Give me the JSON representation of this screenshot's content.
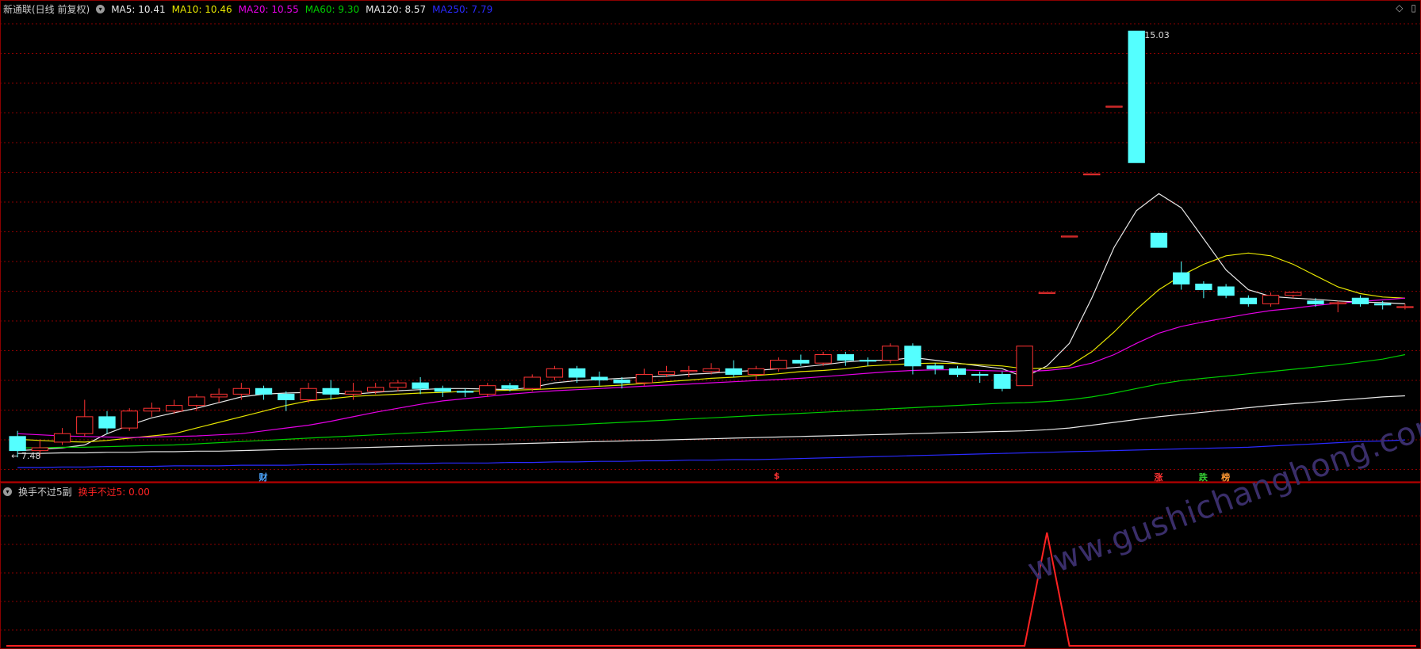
{
  "main": {
    "stock_title": "新通联(日线 前复权)",
    "ma_labels": [
      {
        "key": "MA5",
        "text": "MA5: 10.41",
        "color": "#e8e8e8"
      },
      {
        "key": "MA10",
        "text": "MA10: 10.46",
        "color": "#e6e600"
      },
      {
        "key": "MA20",
        "text": "MA20: 10.55",
        "color": "#e600e6"
      },
      {
        "key": "MA60",
        "text": "MA60: 9.30",
        "color": "#00cc00"
      },
      {
        "key": "MA120",
        "text": "MA120: 8.57",
        "color": "#e8e8e8"
      },
      {
        "key": "MA250",
        "text": "MA250: 7.79",
        "color": "#2a2aff"
      }
    ],
    "high_label": "15.03",
    "low_label": "7.48",
    "markers": [
      {
        "text": "财",
        "color": "#4da6ff"
      },
      {
        "text": "$",
        "color": "#ff3333"
      },
      {
        "text": "涨",
        "color": "#ff3333"
      },
      {
        "text": "跌",
        "color": "#33cc33"
      },
      {
        "text": "榜",
        "color": "#ff9933"
      }
    ],
    "corner_icons": [
      "diamond-icon",
      "window-icon"
    ],
    "colors": {
      "up": "#ff3333",
      "down": "#54ffff",
      "grid": "#8b0000"
    }
  },
  "sub": {
    "indicator_title": "换手不过5副",
    "indicator_value": "换手不过5: 0.00",
    "value_color": "#ff2222"
  },
  "watermark": "www.gushichanghong.com",
  "chart_data": {
    "type": "candlestick",
    "price_range": [
      7.3,
      15.3
    ],
    "candles": [
      [
        7.85,
        7.6,
        7.95,
        7.48
      ],
      [
        7.6,
        7.65,
        7.8,
        7.5
      ],
      [
        7.75,
        7.9,
        8.0,
        7.7
      ],
      [
        7.9,
        8.2,
        8.5,
        7.85
      ],
      [
        8.2,
        8.0,
        8.3,
        7.9
      ],
      [
        8.0,
        8.3,
        8.35,
        7.95
      ],
      [
        8.3,
        8.35,
        8.45,
        8.2
      ],
      [
        8.3,
        8.4,
        8.5,
        8.25
      ],
      [
        8.4,
        8.55,
        8.6,
        8.3
      ],
      [
        8.55,
        8.6,
        8.7,
        8.45
      ],
      [
        8.6,
        8.7,
        8.8,
        8.5
      ],
      [
        8.7,
        8.6,
        8.75,
        8.5
      ],
      [
        8.6,
        8.5,
        8.65,
        8.3
      ],
      [
        8.5,
        8.7,
        8.8,
        8.45
      ],
      [
        8.7,
        8.6,
        8.85,
        8.5
      ],
      [
        8.6,
        8.65,
        8.8,
        8.5
      ],
      [
        8.65,
        8.72,
        8.8,
        8.6
      ],
      [
        8.72,
        8.8,
        8.85,
        8.65
      ],
      [
        8.8,
        8.7,
        8.9,
        8.6
      ],
      [
        8.7,
        8.65,
        8.75,
        8.55
      ],
      [
        8.65,
        8.64,
        8.7,
        8.55
      ],
      [
        8.6,
        8.75,
        8.8,
        8.55
      ],
      [
        8.75,
        8.7,
        8.8,
        8.65
      ],
      [
        8.7,
        8.9,
        8.95,
        8.65
      ],
      [
        8.9,
        9.05,
        9.1,
        8.85
      ],
      [
        9.05,
        8.9,
        9.1,
        8.8
      ],
      [
        8.9,
        8.85,
        9.0,
        8.75
      ],
      [
        8.85,
        8.8,
        8.9,
        8.7
      ],
      [
        8.8,
        8.95,
        9.05,
        8.75
      ],
      [
        8.95,
        9.0,
        9.1,
        8.9
      ],
      [
        9.0,
        9.02,
        9.1,
        8.9
      ],
      [
        9.0,
        9.05,
        9.15,
        8.95
      ],
      [
        9.05,
        8.95,
        9.2,
        8.9
      ],
      [
        8.95,
        9.05,
        9.1,
        8.85
      ],
      [
        9.05,
        9.2,
        9.25,
        9.0
      ],
      [
        9.2,
        9.15,
        9.3,
        9.1
      ],
      [
        9.15,
        9.3,
        9.35,
        9.1
      ],
      [
        9.3,
        9.2,
        9.35,
        9.1
      ],
      [
        9.2,
        9.19,
        9.25,
        9.1
      ],
      [
        9.2,
        9.45,
        9.5,
        9.15
      ],
      [
        9.45,
        9.1,
        9.5,
        8.95
      ],
      [
        9.1,
        9.05,
        9.15,
        8.95
      ],
      [
        9.05,
        8.95,
        9.1,
        8.9
      ],
      [
        8.95,
        8.94,
        9.0,
        8.8
      ],
      [
        8.95,
        8.7,
        9.0,
        8.65
      ],
      [
        8.75,
        9.45,
        9.45,
        8.75
      ],
      [
        10.4,
        10.4,
        10.4,
        10.4
      ],
      [
        11.4,
        11.4,
        11.4,
        11.4
      ],
      [
        12.5,
        12.5,
        12.5,
        12.5
      ],
      [
        13.7,
        13.7,
        13.7,
        13.7
      ],
      [
        15.03,
        12.7,
        15.03,
        12.7
      ],
      [
        11.45,
        11.2,
        11.45,
        11.2
      ],
      [
        10.75,
        10.55,
        10.95,
        10.45
      ],
      [
        10.55,
        10.45,
        10.6,
        10.3
      ],
      [
        10.5,
        10.35,
        10.55,
        10.3
      ],
      [
        10.3,
        10.2,
        10.35,
        10.15
      ],
      [
        10.2,
        10.35,
        10.4,
        10.15
      ],
      [
        10.35,
        10.4,
        10.42,
        10.3
      ],
      [
        10.25,
        10.2,
        10.3,
        10.15
      ],
      [
        10.2,
        10.22,
        10.25,
        10.05
      ],
      [
        10.3,
        10.2,
        10.35,
        10.15
      ],
      [
        10.2,
        10.18,
        10.25,
        10.1
      ],
      [
        10.15,
        10.15,
        10.2,
        10.1
      ]
    ],
    "ma_series": [
      {
        "name": "MA5",
        "values": [
          7.6,
          7.62,
          7.65,
          7.7,
          7.9,
          8.05,
          8.18,
          8.27,
          8.35,
          8.45,
          8.55,
          8.6,
          8.62,
          8.63,
          8.62,
          8.6,
          8.63,
          8.66,
          8.68,
          8.7,
          8.7,
          8.69,
          8.68,
          8.72,
          8.8,
          8.84,
          8.86,
          8.88,
          8.9,
          8.92,
          8.95,
          8.97,
          9.0,
          9.02,
          9.05,
          9.08,
          9.12,
          9.17,
          9.2,
          9.2,
          9.25,
          9.2,
          9.15,
          9.1,
          9.05,
          8.9,
          9.1,
          9.5,
          10.3,
          11.2,
          11.85,
          12.15,
          11.9,
          11.35,
          10.8,
          10.45,
          10.33,
          10.3,
          10.28,
          10.25,
          10.23,
          10.22,
          10.2
        ]
      },
      {
        "name": "MA10",
        "values": [
          7.8,
          7.78,
          7.76,
          7.75,
          7.78,
          7.82,
          7.86,
          7.9,
          8.0,
          8.1,
          8.2,
          8.3,
          8.4,
          8.48,
          8.52,
          8.56,
          8.58,
          8.6,
          8.62,
          8.63,
          8.65,
          8.66,
          8.67,
          8.68,
          8.7,
          8.72,
          8.74,
          8.76,
          8.79,
          8.82,
          8.85,
          8.88,
          8.9,
          8.93,
          8.96,
          9.0,
          9.02,
          9.05,
          9.1,
          9.12,
          9.14,
          9.15,
          9.14,
          9.12,
          9.1,
          9.05,
          9.06,
          9.1,
          9.35,
          9.7,
          10.1,
          10.45,
          10.7,
          10.9,
          11.05,
          11.1,
          11.05,
          10.9,
          10.7,
          10.5,
          10.38,
          10.32,
          10.3
        ]
      },
      {
        "name": "MA20",
        "values": [
          7.9,
          7.88,
          7.86,
          7.85,
          7.84,
          7.83,
          7.84,
          7.85,
          7.86,
          7.88,
          7.9,
          7.95,
          8.0,
          8.05,
          8.12,
          8.2,
          8.28,
          8.35,
          8.42,
          8.48,
          8.52,
          8.56,
          8.6,
          8.63,
          8.66,
          8.68,
          8.7,
          8.72,
          8.74,
          8.76,
          8.78,
          8.8,
          8.82,
          8.84,
          8.86,
          8.88,
          8.91,
          8.94,
          8.97,
          9.0,
          9.02,
          9.03,
          9.03,
          9.02,
          9.01,
          9.0,
          9.02,
          9.06,
          9.15,
          9.3,
          9.5,
          9.68,
          9.8,
          9.88,
          9.95,
          10.02,
          10.08,
          10.12,
          10.17,
          10.21,
          10.24,
          10.27,
          10.3
        ]
      },
      {
        "name": "MA60",
        "values": [
          7.65,
          7.65,
          7.66,
          7.66,
          7.67,
          7.68,
          7.69,
          7.7,
          7.72,
          7.74,
          7.76,
          7.78,
          7.8,
          7.82,
          7.84,
          7.86,
          7.88,
          7.9,
          7.92,
          7.94,
          7.96,
          7.98,
          8.0,
          8.02,
          8.04,
          8.06,
          8.08,
          8.1,
          8.12,
          8.14,
          8.16,
          8.18,
          8.2,
          8.22,
          8.24,
          8.26,
          8.28,
          8.3,
          8.32,
          8.34,
          8.36,
          8.38,
          8.4,
          8.42,
          8.44,
          8.45,
          8.47,
          8.5,
          8.55,
          8.62,
          8.7,
          8.78,
          8.84,
          8.88,
          8.92,
          8.96,
          9.0,
          9.04,
          9.08,
          9.12,
          9.17,
          9.22,
          9.3
        ]
      },
      {
        "name": "MA120",
        "values": [
          7.55,
          7.55,
          7.56,
          7.56,
          7.57,
          7.57,
          7.58,
          7.58,
          7.59,
          7.59,
          7.6,
          7.61,
          7.62,
          7.63,
          7.64,
          7.65,
          7.66,
          7.67,
          7.68,
          7.69,
          7.7,
          7.71,
          7.72,
          7.73,
          7.74,
          7.75,
          7.76,
          7.77,
          7.78,
          7.79,
          7.8,
          7.81,
          7.82,
          7.83,
          7.84,
          7.85,
          7.86,
          7.87,
          7.88,
          7.89,
          7.9,
          7.91,
          7.92,
          7.93,
          7.94,
          7.95,
          7.97,
          8.0,
          8.05,
          8.1,
          8.15,
          8.2,
          8.24,
          8.28,
          8.32,
          8.36,
          8.4,
          8.43,
          8.46,
          8.49,
          8.52,
          8.55,
          8.57
        ]
      },
      {
        "name": "MA250",
        "values": [
          7.3,
          7.3,
          7.31,
          7.31,
          7.32,
          7.32,
          7.32,
          7.33,
          7.33,
          7.33,
          7.34,
          7.34,
          7.34,
          7.35,
          7.35,
          7.36,
          7.36,
          7.37,
          7.37,
          7.38,
          7.38,
          7.38,
          7.39,
          7.39,
          7.4,
          7.4,
          7.41,
          7.41,
          7.42,
          7.42,
          7.43,
          7.43,
          7.44,
          7.44,
          7.45,
          7.46,
          7.47,
          7.48,
          7.49,
          7.5,
          7.51,
          7.52,
          7.53,
          7.54,
          7.55,
          7.56,
          7.57,
          7.58,
          7.59,
          7.6,
          7.61,
          7.62,
          7.63,
          7.64,
          7.65,
          7.66,
          7.68,
          7.7,
          7.72,
          7.74,
          7.76,
          7.77,
          7.79
        ]
      }
    ],
    "indicator": {
      "name": "换手不过5",
      "values": [
        0,
        0,
        0,
        0,
        0,
        0,
        0,
        0,
        0,
        0,
        0,
        0,
        0,
        0,
        0,
        0,
        0,
        0,
        0,
        0,
        0,
        0,
        0,
        0,
        0,
        0,
        0,
        0,
        0,
        0,
        0,
        0,
        0,
        0,
        0,
        0,
        0,
        0,
        0,
        0,
        0,
        0,
        0,
        0,
        0,
        0,
        1,
        0,
        0,
        0,
        0,
        0,
        0,
        0,
        0,
        0,
        0,
        0,
        0,
        0,
        0,
        0,
        0
      ],
      "ylim": [
        0,
        1
      ]
    },
    "marker_positions": [
      11,
      34,
      51,
      53,
      54
    ]
  }
}
